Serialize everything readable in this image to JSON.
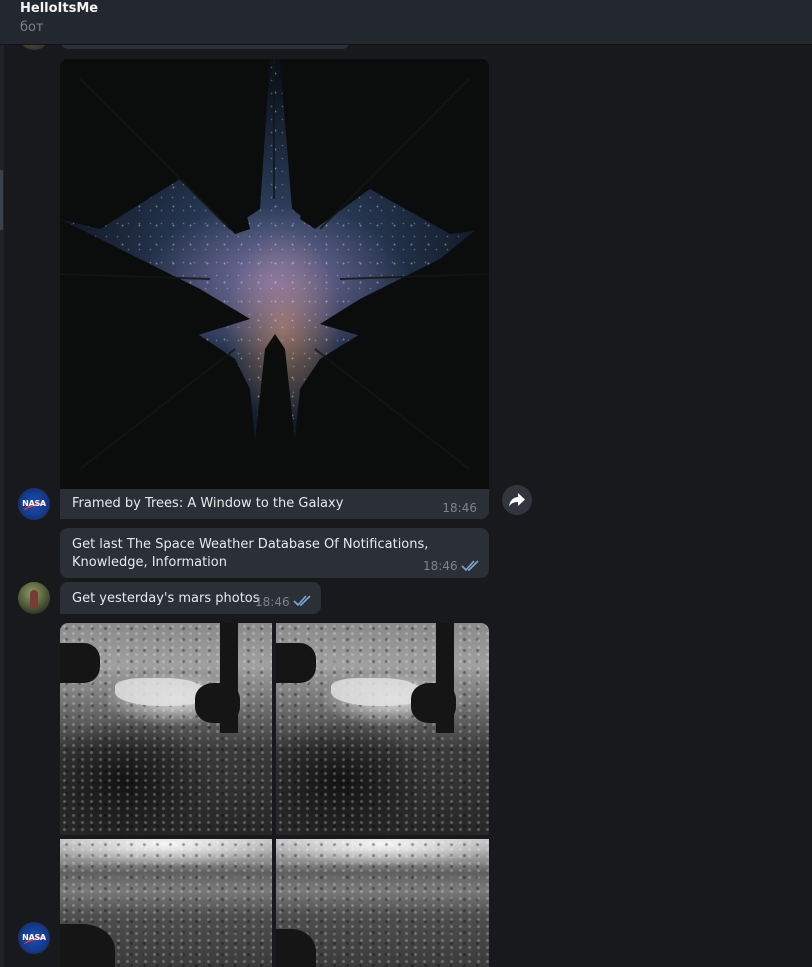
{
  "header": {
    "title": "HelloItsMe",
    "subtitle": "бот"
  },
  "messages": {
    "photo_caption": "Framed by Trees: A Window to the Galaxy",
    "photo_time": "18:46",
    "outgoing_1": {
      "text": "Get last The Space Weather Database Of Notifications, Knowledge, Information",
      "time": "18:46"
    },
    "outgoing_2": {
      "text": "Get yesterday's mars photos",
      "time": "18:46"
    }
  },
  "avatars": {
    "bot_logo_text": "NASA"
  },
  "icons": {
    "forward": "forward-arrow-icon",
    "read_receipt": "double-check-icon"
  },
  "colors": {
    "background": "#17191d",
    "bubble": "#2b2f36",
    "header": "#23272e",
    "check": "#7fa8d8"
  }
}
